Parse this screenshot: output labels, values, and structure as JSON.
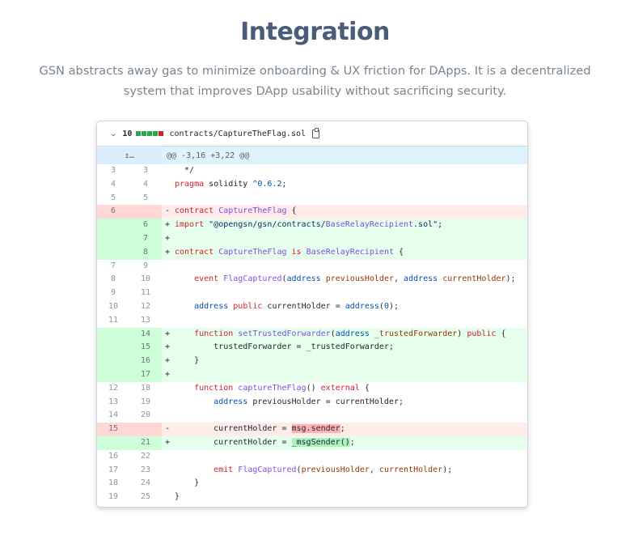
{
  "page": {
    "title": "Integration",
    "description": "GSN abstracts away gas to minimize onboarding & UX friction for DApps. It is a decentralized system that improves DApp usability without sacrificing security."
  },
  "diff": {
    "file_header": {
      "chevron_icon": "chevron-down-icon",
      "change_count": "10",
      "diffstat_blocks": [
        "add",
        "add",
        "add",
        "add",
        "del"
      ],
      "filename": "contracts/CaptureTheFlag.sol",
      "copy_icon": "clipboard-icon"
    },
    "hunk_header": "@@ -3,16 +3,22 @@",
    "expand_icon": "expand-up-icon",
    "lines": [
      {
        "old": "3",
        "new": "3",
        "type": "ctx",
        "marker": "",
        "code": "  */"
      },
      {
        "old": "4",
        "new": "4",
        "type": "ctx",
        "marker": "",
        "code": "pragma solidity ^0.6.2;"
      },
      {
        "old": "5",
        "new": "5",
        "type": "ctx",
        "marker": "",
        "code": ""
      },
      {
        "old": "6",
        "new": "",
        "type": "del",
        "marker": "-",
        "code": "contract CaptureTheFlag {"
      },
      {
        "old": "",
        "new": "6",
        "type": "add",
        "marker": "+",
        "code": "import \"@opengsn/gsn/contracts/BaseRelayRecipient.sol\";"
      },
      {
        "old": "",
        "new": "7",
        "type": "add",
        "marker": "+",
        "code": ""
      },
      {
        "old": "",
        "new": "8",
        "type": "add",
        "marker": "+",
        "code": "contract CaptureTheFlag is BaseRelayRecipient {"
      },
      {
        "old": "7",
        "new": "9",
        "type": "ctx",
        "marker": "",
        "code": ""
      },
      {
        "old": "8",
        "new": "10",
        "type": "ctx",
        "marker": "",
        "code": "    event FlagCaptured(address previousHolder, address currentHolder);"
      },
      {
        "old": "9",
        "new": "11",
        "type": "ctx",
        "marker": "",
        "code": ""
      },
      {
        "old": "10",
        "new": "12",
        "type": "ctx",
        "marker": "",
        "code": "    address public currentHolder = address(0);"
      },
      {
        "old": "11",
        "new": "13",
        "type": "ctx",
        "marker": "",
        "code": ""
      },
      {
        "old": "",
        "new": "14",
        "type": "add",
        "marker": "+",
        "code": "    function setTrustedForwarder(address _trustedForwarder) public {"
      },
      {
        "old": "",
        "new": "15",
        "type": "add",
        "marker": "+",
        "code": "        trustedForwarder = _trustedForwarder;"
      },
      {
        "old": "",
        "new": "16",
        "type": "add",
        "marker": "+",
        "code": "    }"
      },
      {
        "old": "",
        "new": "17",
        "type": "add",
        "marker": "+",
        "code": ""
      },
      {
        "old": "12",
        "new": "18",
        "type": "ctx",
        "marker": "",
        "code": "    function captureTheFlag() external {"
      },
      {
        "old": "13",
        "new": "19",
        "type": "ctx",
        "marker": "",
        "code": "        address previousHolder = currentHolder;"
      },
      {
        "old": "14",
        "new": "20",
        "type": "ctx",
        "marker": "",
        "code": ""
      },
      {
        "old": "15",
        "new": "",
        "type": "del",
        "marker": "-",
        "code": "        currentHolder = msg.sender;"
      },
      {
        "old": "",
        "new": "21",
        "type": "add",
        "marker": "+",
        "code": "        currentHolder = _msgSender();"
      },
      {
        "old": "16",
        "new": "22",
        "type": "ctx",
        "marker": "",
        "code": ""
      },
      {
        "old": "17",
        "new": "23",
        "type": "ctx",
        "marker": "",
        "code": "        emit FlagCaptured(previousHolder, currentHolder);"
      },
      {
        "old": "18",
        "new": "24",
        "type": "ctx",
        "marker": "",
        "code": "    }"
      },
      {
        "old": "19",
        "new": "25",
        "type": "ctx",
        "marker": "",
        "code": "}"
      }
    ]
  }
}
